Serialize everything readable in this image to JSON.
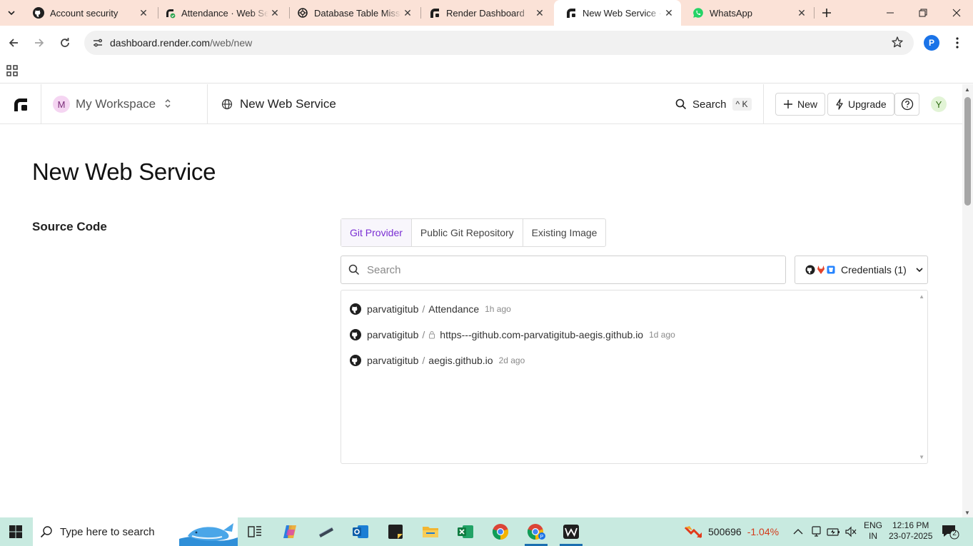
{
  "browser": {
    "tabs": [
      {
        "title": "Account security",
        "icon": "github-icon",
        "active": false
      },
      {
        "title": "Attendance · Web Service",
        "icon": "render-logo-icon",
        "active": false
      },
      {
        "title": "Database Table Missing",
        "icon": "chatgpt-icon",
        "active": false
      },
      {
        "title": "Render Dashboard",
        "icon": "render-logo-icon",
        "active": false
      },
      {
        "title": "New Web Service · Render",
        "icon": "render-logo-icon",
        "active": true
      },
      {
        "title": "WhatsApp",
        "icon": "whatsapp-icon",
        "active": false
      }
    ],
    "url_host": "dashboard.render.com",
    "url_path": "/web/new",
    "profile_initial": "P"
  },
  "header": {
    "workspace_initial": "M",
    "workspace_name": "My Workspace",
    "page_name": "New Web Service",
    "search_label": "Search",
    "search_shortcut": "^ K",
    "new_label": "New",
    "upgrade_label": "Upgrade",
    "user_initial": "Y"
  },
  "main": {
    "title": "New Web Service",
    "section_title": "Source Code",
    "source_tabs": [
      "Git Provider",
      "Public Git Repository",
      "Existing Image"
    ],
    "active_source_tab": 0,
    "search_placeholder": "Search",
    "credentials_label": "Credentials (1)",
    "repos": [
      {
        "owner": "parvatigitub",
        "name": "Attendance",
        "private": false,
        "ago": "1h ago"
      },
      {
        "owner": "parvatigitub",
        "name": "https---github.com-parvatigitub-aegis.github.io",
        "private": true,
        "ago": "1d ago"
      },
      {
        "owner": "parvatigitub",
        "name": "aegis.github.io",
        "private": false,
        "ago": "2d ago"
      }
    ]
  },
  "taskbar": {
    "search_placeholder": "Type here to search",
    "stock_value": "500696",
    "stock_change": "-1.04%",
    "lang_line1": "ENG",
    "lang_line2": "IN",
    "time": "12:16 PM",
    "date": "23-07-2025",
    "notification_count": "2"
  }
}
